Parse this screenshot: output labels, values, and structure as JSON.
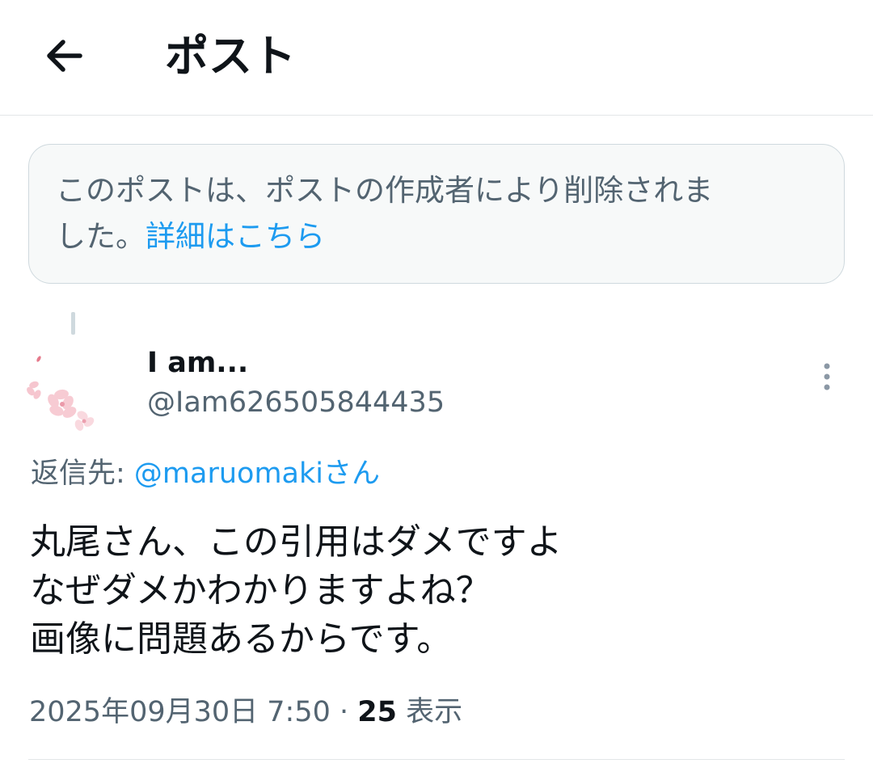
{
  "header": {
    "title": "ポスト",
    "back_icon": "arrow-left-icon"
  },
  "notice": {
    "line1": "このポストは、ポストの作成者により削除されま",
    "line2_text": "した。",
    "link_label": "詳細はこちら"
  },
  "post": {
    "author_name": "I am...",
    "author_handle": "@Iam626505844435",
    "avatar_icon": "sakura-blossom-avatar",
    "more_icon": "more-vertical-icon",
    "reply_prefix": "返信先: ",
    "reply_handle": "@maruomakiさん",
    "body_lines": [
      "丸尾さん、この引用はダメですよ",
      "なぜダメかわかりますよね？",
      "画像に問題あるからです。"
    ],
    "timestamp": "2025年09月30日 7:50",
    "separator": " · ",
    "views_count": "25",
    "views_label": " 表示"
  },
  "colors": {
    "text_primary": "#0f1419",
    "text_secondary": "#536471",
    "link": "#1d9bf0",
    "notice_bg": "#f7f9f9",
    "border": "#cfd9de"
  }
}
